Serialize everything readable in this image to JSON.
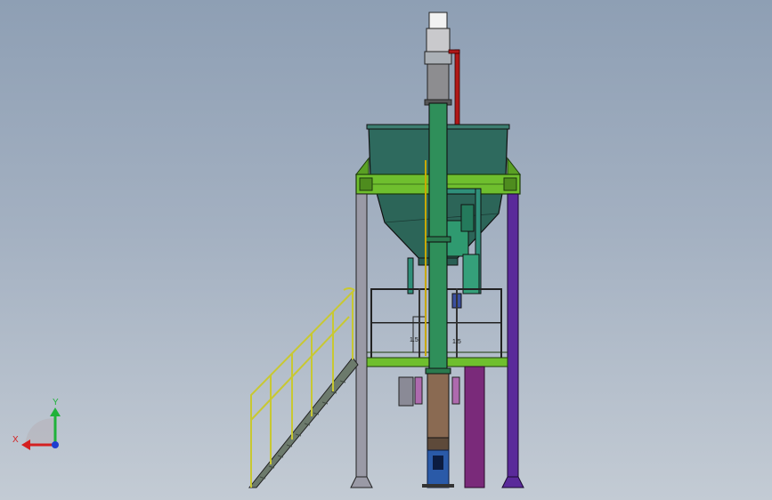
{
  "viewport": {
    "background_top": "#8e9fb4",
    "background_bottom": "#c3cbd4"
  },
  "triad": {
    "x_label": "X",
    "y_label": "Y",
    "x_color": "#d42020",
    "y_color": "#1fb23a",
    "z_color": "#1e3fd0"
  },
  "model": {
    "hopper_color": "#2e6a5e",
    "frame_green": "#6fbf2e",
    "elevator_green": "#2f8f5a",
    "stair_yellow": "#c8c832",
    "leg_purple": "#5a2a9a",
    "leg_gray": "#9a9aa6",
    "magenta_column": "#7a2a7a",
    "motor_blue": "#2a5aa8",
    "pipe_red": "#b01818",
    "scale_text_left": "1.5",
    "scale_text_right": "1.5"
  }
}
